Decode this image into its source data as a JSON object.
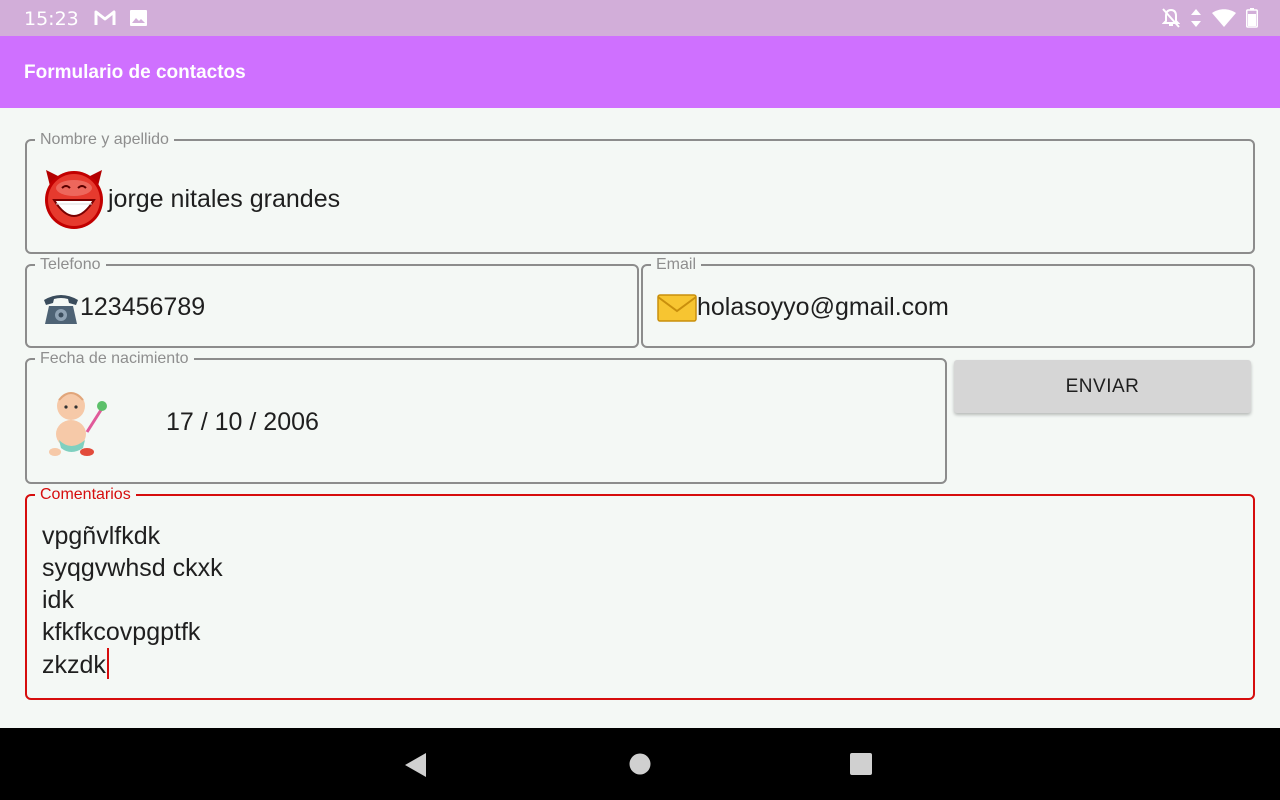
{
  "status_bar": {
    "time": "15:23",
    "left_icons": [
      "gmail-icon",
      "gallery-icon"
    ],
    "right_icons": [
      "notifications-off-icon",
      "data-arrows-icon",
      "wifi-icon",
      "battery-icon"
    ]
  },
  "app_bar": {
    "title": "Formulario de contactos",
    "color": "#cf70ff"
  },
  "form": {
    "name": {
      "label": "Nombre y apellido",
      "value": "jorge nitales grandes",
      "icon": "devil-face-icon"
    },
    "phone": {
      "label": "Telefono",
      "value": "123456789",
      "icon": "telephone-icon"
    },
    "email": {
      "label": "Email",
      "value": "holasoyyo@gmail.com",
      "icon": "envelope-icon"
    },
    "birthdate": {
      "label": "Fecha de nacimiento",
      "value": "17 / 10 / 2006",
      "icon": "baby-icon"
    },
    "submit_label": "ENVIAR",
    "comments": {
      "label": "Comentarios",
      "focused": true,
      "focus_color": "#d60d0d",
      "lines": [
        "vpgñvlfkdk",
        "syqgvwhsd ckxk",
        "idk",
        "kfkfkcovpgptfk",
        "zkzdk"
      ]
    }
  },
  "nav_bar": {
    "buttons": [
      "back-icon",
      "home-icon",
      "recents-icon"
    ]
  }
}
